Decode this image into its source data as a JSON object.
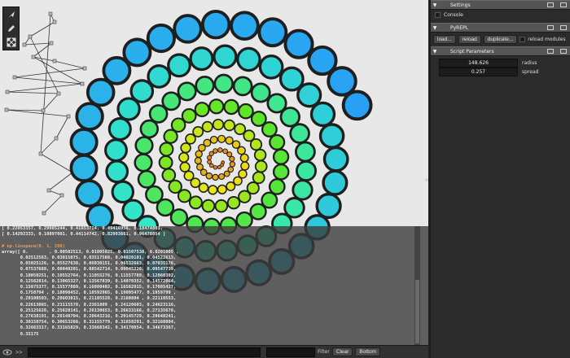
{
  "left_toolbar": {
    "icons": [
      "arrow-pointer-icon",
      "pencil-icon",
      "expand-icon"
    ]
  },
  "console": {
    "lines": [
      "[ 0.22053357, 0.29985244, 0.41653714, 0.49416956, 0.18474801,",
      "[ 0.14292333, 0.10897001, 0.44114742, 0.82993661, 0.96478854 ]",
      "",
      "# np.linspace(0, 1, 200)",
      "array([ 0.        , 0.00502513, 0.01005025, 0.01507538, 0.0201005 ,",
      "       0.02512563, 0.03015075, 0.03517588, 0.04020101, 0.04522613,",
      "       0.05025126, 0.05527638, 0.06030151, 0.06532663, 0.07035176,",
      "       0.07537688, 0.08040201, 0.08542714, 0.09045226, 0.09547739,",
      "       0.10050251, 0.10552764, 0.11055276, 0.11557789, 0.12060302,",
      "       0.12562814, 0.13065327, 0.13567839, 0.14070352, 0.14572864,",
      "       0.15075377, 0.15577889, 0.16080402, 0.16582915, 0.17085427,",
      "       0.1758794 , 0.18090452, 0.18592965, 0.19095477, 0.1959799 ,",
      "       0.20100503, 0.20603015, 0.21105528, 0.2160804 , 0.22110553,",
      "       0.22613065, 0.23115578, 0.2361809 , 0.24120603, 0.24623116,",
      "       0.25125628, 0.25628141, 0.26130653, 0.26633166, 0.27135678,",
      "       0.27638191, 0.28140704, 0.28643216, 0.29145729, 0.29648241,",
      "       0.30150754, 0.30653266, 0.31155779, 0.31658291, 0.32160804,",
      "       0.32663317, 0.33165829, 0.33668342, 0.34170854, 0.34673367,",
      "       0.35175"
    ],
    "prompt": ">>",
    "input_value": "",
    "filter_label": "Filter",
    "filter_value": "",
    "clear_label": "Clear",
    "bottom_label": "Bottom"
  },
  "panel": {
    "settings": {
      "title": "Settings",
      "console_label": "Console"
    },
    "pyrepl": {
      "title": "PyREPL",
      "load_label": "load...",
      "reload_label": "reload",
      "duplicate_label": "duplicate...",
      "reload_modules_label": "reload modules"
    },
    "params": {
      "title": "Script Parameters",
      "items": [
        {
          "value": "148.626",
          "name": "radius"
        },
        {
          "value": "0.257",
          "name": "spread"
        }
      ]
    }
  }
}
